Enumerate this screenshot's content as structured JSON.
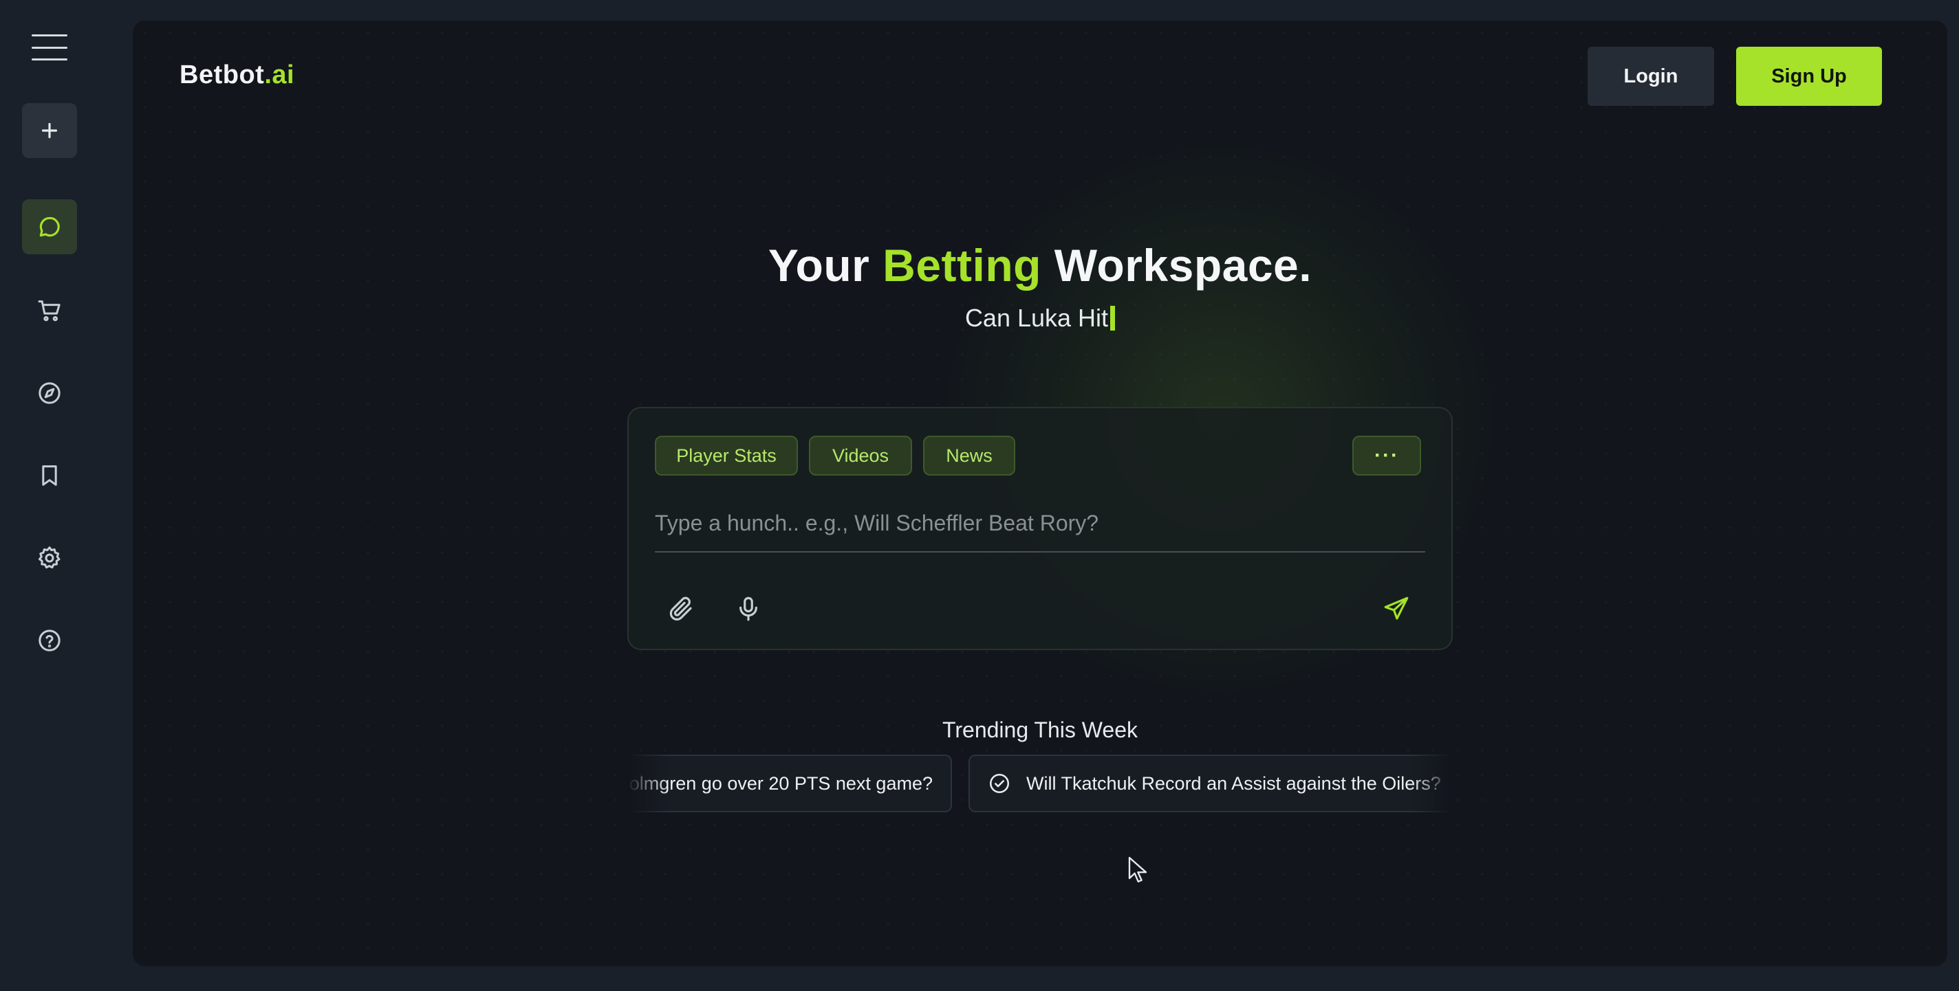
{
  "sidebar": {
    "icons": [
      "menu-icon",
      "plus-icon",
      "chat-icon",
      "cart-icon",
      "compass-icon",
      "bookmark-icon",
      "gear-icon",
      "help-icon"
    ]
  },
  "header": {
    "logo_main": "Betbot",
    "logo_accent": ".ai",
    "login_label": "Login",
    "signup_label": "Sign Up"
  },
  "hero": {
    "title_part1": "Your ",
    "title_accent": "Betting",
    "title_part2": " Workspace.",
    "subtitle": "Can Luka Hit"
  },
  "composer": {
    "chips": [
      "Player Stats",
      "Videos",
      "News"
    ],
    "more_label": "···",
    "placeholder": "Type a hunch.. e.g., Will Scheffler Beat Rory?",
    "value": ""
  },
  "trending": {
    "title": "Trending This Week",
    "items": [
      "olmgren go over 20 PTS next game?",
      "Will Tkatchuk Record an Assist against the Oilers?"
    ]
  },
  "colors": {
    "accent": "#a6e22a",
    "background": "#12161c",
    "sidebar": "#1a202a"
  }
}
